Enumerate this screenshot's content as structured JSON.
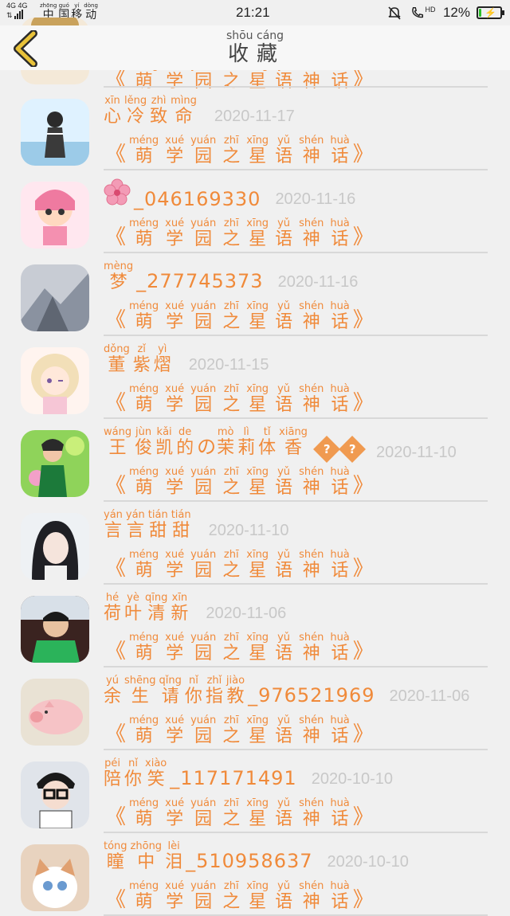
{
  "status": {
    "net_top": "4G 4G",
    "net_bottom": "⇅",
    "carrier": [
      {
        "ch": "中",
        "py": "zhōng"
      },
      {
        "ch": "国",
        "py": "guó"
      },
      {
        "ch": "移",
        "py": "yí"
      },
      {
        "ch": "动",
        "py": "dòng"
      }
    ],
    "time": "21:21",
    "hd": "HD",
    "battery": "12%",
    "battery_level": 0.12
  },
  "header": {
    "title_pinyin": "shōu cáng",
    "title": "收藏",
    "back_icon": "chevron-left-icon"
  },
  "subtitle": {
    "open": "《",
    "close": "》",
    "chars": [
      {
        "ch": "萌",
        "py": "méng"
      },
      {
        "ch": "学",
        "py": "xué"
      },
      {
        "ch": "园",
        "py": "yuán"
      },
      {
        "ch": "之",
        "py": "zhī"
      },
      {
        "ch": "星",
        "py": "xīng"
      },
      {
        "ch": "语",
        "py": "yǔ"
      },
      {
        "ch": "神",
        "py": "shén"
      },
      {
        "ch": "话",
        "py": "huà"
      }
    ]
  },
  "items": [
    {
      "name": [],
      "suffix": "",
      "date": "",
      "avatar": "partial"
    },
    {
      "name": [
        {
          "ch": "心",
          "py": "xīn"
        },
        {
          "ch": "冷",
          "py": "lěng"
        },
        {
          "ch": "致",
          "py": "zhì"
        },
        {
          "ch": "命",
          "py": "mìng"
        }
      ],
      "suffix": "",
      "date": "2020-11-17",
      "avatar": "blue"
    },
    {
      "name": [],
      "flower": true,
      "suffix": "_046169330",
      "date": "2020-11-16",
      "avatar": "pink"
    },
    {
      "name": [
        {
          "ch": "梦",
          "py": "mèng"
        }
      ],
      "suffix": "_277745373",
      "date": "2020-11-16",
      "avatar": "gray"
    },
    {
      "name": [
        {
          "ch": "董",
          "py": "dǒng"
        },
        {
          "ch": "紫",
          "py": "zǐ"
        },
        {
          "ch": "熠",
          "py": "yì"
        }
      ],
      "suffix": "",
      "date": "2020-11-15",
      "avatar": "anime"
    },
    {
      "name": [
        {
          "ch": "王",
          "py": "wáng"
        },
        {
          "ch": "俊",
          "py": "jùn"
        },
        {
          "ch": "凯",
          "py": "kǎi"
        },
        {
          "ch": "的",
          "py": "de"
        },
        {
          "ch": "の",
          "py": ""
        },
        {
          "ch": "茉",
          "py": "mò"
        },
        {
          "ch": "莉",
          "py": "lì"
        },
        {
          "ch": "体",
          "py": "tǐ"
        },
        {
          "ch": "香",
          "py": "xiāng"
        }
      ],
      "qmarks": 2,
      "suffix": "",
      "date": "2020-11-10",
      "avatar": "green"
    },
    {
      "name": [
        {
          "ch": "言",
          "py": "yán"
        },
        {
          "ch": "言",
          "py": "yán"
        },
        {
          "ch": "甜",
          "py": "tián"
        },
        {
          "ch": "甜",
          "py": "tián"
        }
      ],
      "suffix": "",
      "date": "2020-11-10",
      "avatar": "portrait"
    },
    {
      "name": [
        {
          "ch": "荷",
          "py": "hé"
        },
        {
          "ch": "叶",
          "py": "yè"
        },
        {
          "ch": "清",
          "py": "qīng"
        },
        {
          "ch": "新",
          "py": "xīn"
        }
      ],
      "suffix": "",
      "date": "2020-11-06",
      "avatar": "boy"
    },
    {
      "name": [
        {
          "ch": "余",
          "py": "yú"
        },
        {
          "ch": "生",
          "py": "shēng"
        },
        {
          "ch": "请",
          "py": "qǐng"
        },
        {
          "ch": "你",
          "py": "nǐ"
        },
        {
          "ch": "指",
          "py": "zhǐ"
        },
        {
          "ch": "教",
          "py": "jiào"
        }
      ],
      "suffix": "_976521969",
      "date": "2020-11-06",
      "avatar": "pig"
    },
    {
      "name": [
        {
          "ch": "陪",
          "py": "péi"
        },
        {
          "ch": "你",
          "py": "nǐ"
        },
        {
          "ch": "笑",
          "py": "xiào"
        }
      ],
      "suffix": "_117171491",
      "date": "2020-10-10",
      "avatar": "glasses"
    },
    {
      "name": [
        {
          "ch": "瞳",
          "py": "tóng"
        },
        {
          "ch": "中",
          "py": "zhōng"
        },
        {
          "ch": "泪",
          "py": "lèi"
        }
      ],
      "suffix": "_510958637",
      "date": "2020-10-10",
      "avatar": "cat"
    }
  ]
}
